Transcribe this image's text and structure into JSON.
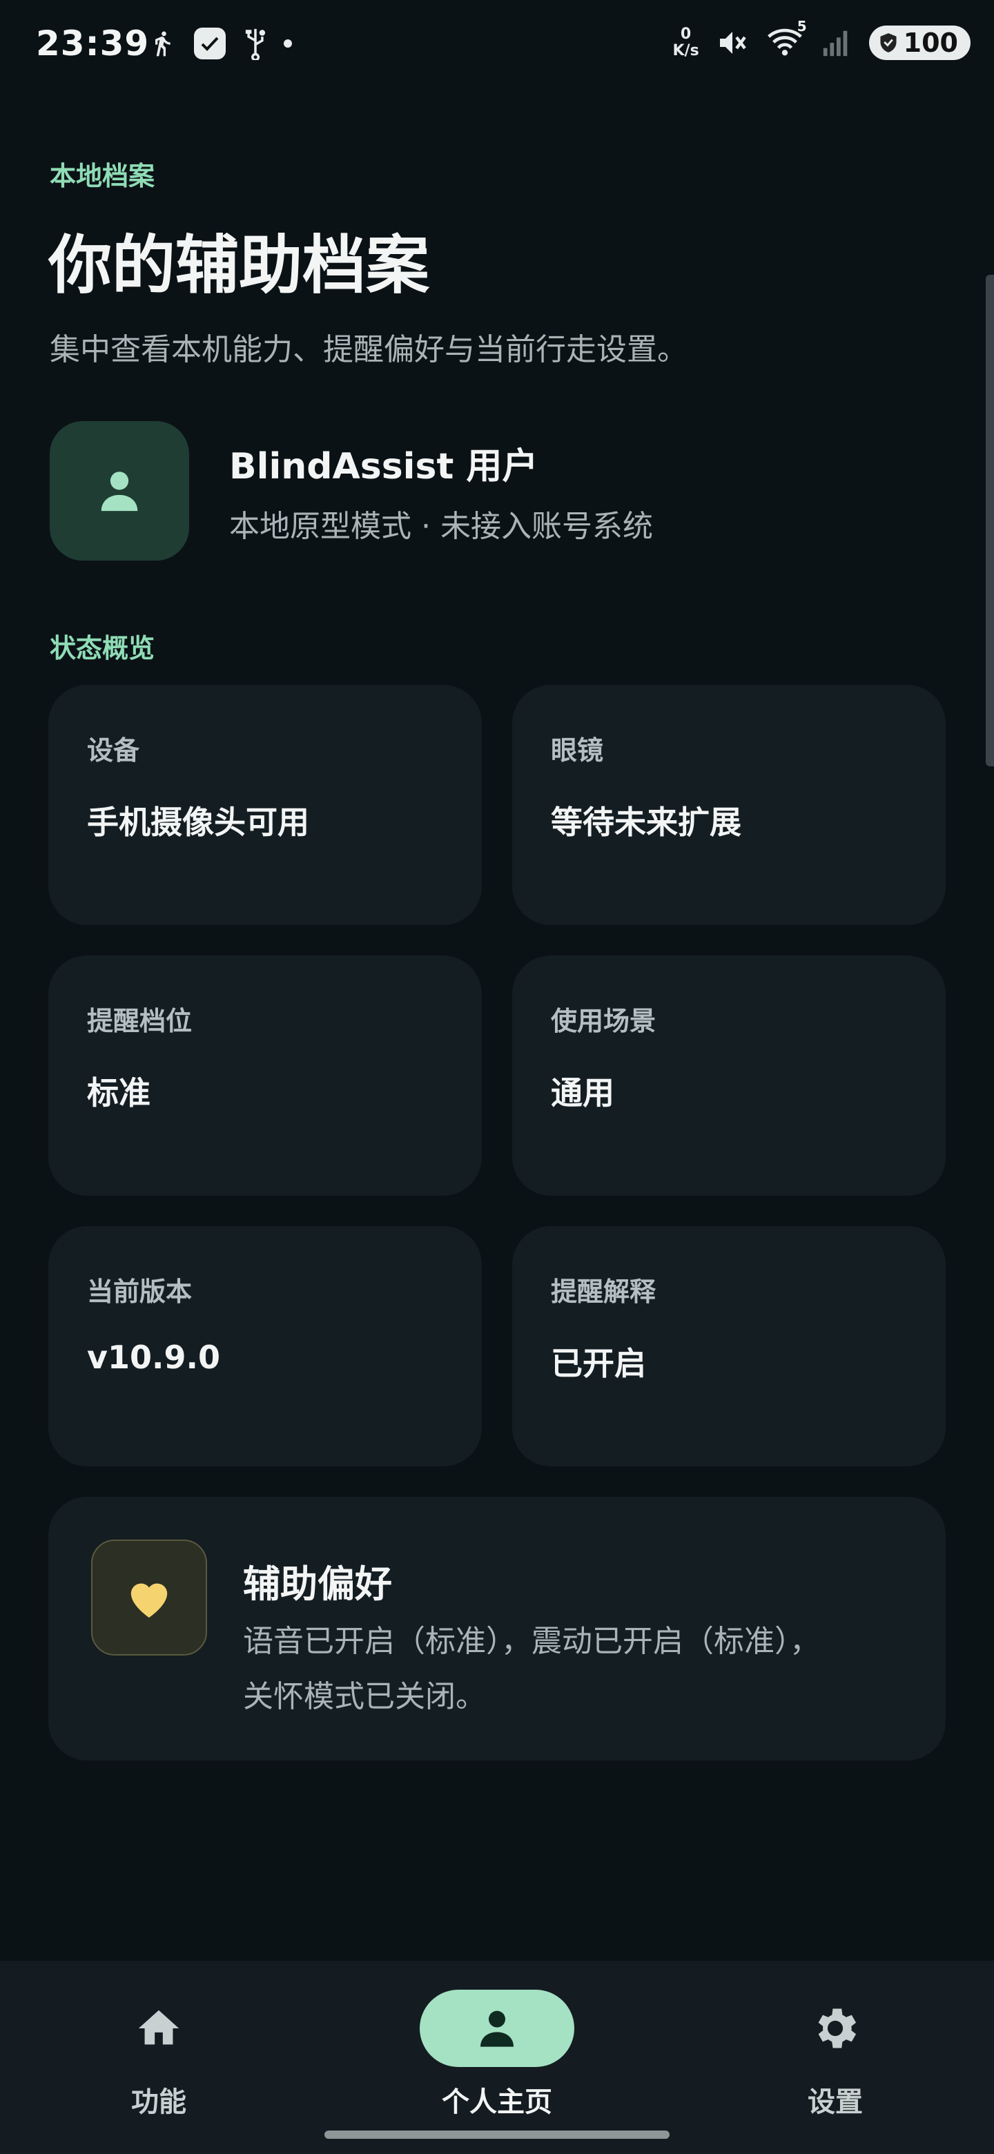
{
  "status_bar": {
    "time": "23:39",
    "net_speed_value": "0",
    "net_speed_unit": "K/s",
    "wifi_badge": "5",
    "battery": "100"
  },
  "header": {
    "eyebrow": "本地档案",
    "title": "你的辅助档案",
    "subtitle": "集中查看本机能力、提醒偏好与当前行走设置。"
  },
  "profile": {
    "name": "BlindAssist 用户",
    "mode": "本地原型模式 · 未接入账号系统"
  },
  "overview": {
    "section_label": "状态概览",
    "cards": [
      {
        "label": "设备",
        "value": "手机摄像头可用"
      },
      {
        "label": "眼镜",
        "value": "等待未来扩展"
      },
      {
        "label": "提醒档位",
        "value": "标准"
      },
      {
        "label": "使用场景",
        "value": "通用"
      },
      {
        "label": "当前版本",
        "value": "v10.9.0"
      },
      {
        "label": "提醒解释",
        "value": "已开启"
      }
    ]
  },
  "preference": {
    "title": "辅助偏好",
    "description": "语音已开启（标准），震动已开启（标准），关怀模式已关闭。"
  },
  "nav": {
    "items": [
      {
        "label": "功能",
        "icon": "home-icon"
      },
      {
        "label": "个人主页",
        "icon": "person-icon",
        "active": true
      },
      {
        "label": "设置",
        "icon": "gear-icon"
      }
    ]
  },
  "colors": {
    "background": "#0b1216",
    "card": "#141d22",
    "accent": "#8fdcb6",
    "nav_active": "#a4e2c3",
    "heart": "#f5d36e"
  }
}
